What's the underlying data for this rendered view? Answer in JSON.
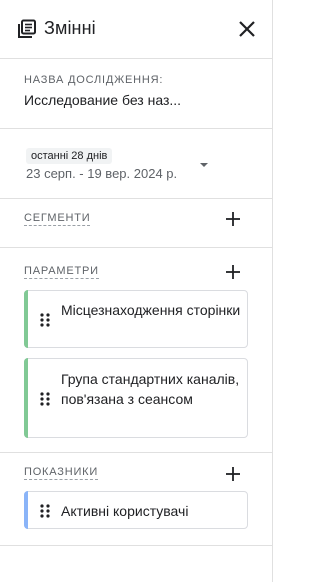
{
  "header": {
    "title": "Змінні",
    "header_icon": "list-box-icon",
    "close_icon": "close-icon"
  },
  "study": {
    "label": "НАЗВА ДОСЛІДЖЕННЯ:",
    "name": "Исследование без наз..."
  },
  "date": {
    "badge": "останні 28 днів",
    "range": "23 серп. - 19 вер. 2024 р."
  },
  "segments": {
    "title": "СЕГМЕНТИ"
  },
  "parameters": {
    "title": "ПАРАМЕТРИ",
    "items": [
      {
        "label": "Місцезнаходження сторінки"
      },
      {
        "label": "Група стандартних каналів, пов'язана з сеансом"
      }
    ]
  },
  "metrics": {
    "title": "ПОКАЗНИКИ",
    "items": [
      {
        "label": "Активні користувачі"
      }
    ]
  },
  "colors": {
    "dimension_stripe": "#81c995",
    "metric_stripe": "#8ab4f8",
    "text": "#202124",
    "muted": "#5f6368"
  }
}
